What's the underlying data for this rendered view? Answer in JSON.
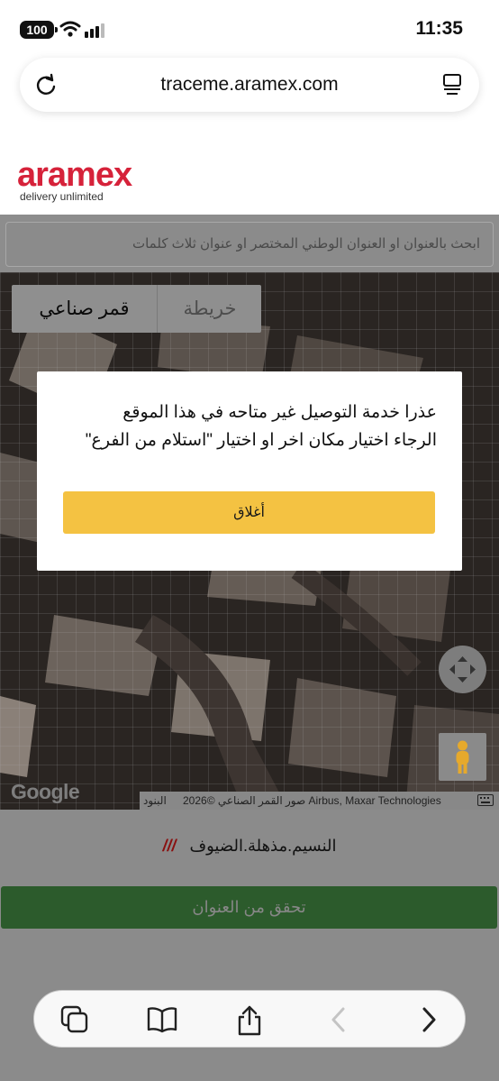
{
  "status_bar": {
    "battery": "100",
    "time": "11:35"
  },
  "browser": {
    "url": "traceme.aramex.com"
  },
  "header": {
    "brand": "aramex",
    "tagline": "delivery unlimited"
  },
  "search": {
    "placeholder": "ابحث بالعنوان او العنوان الوطني المختصر او عنوان ثلاث كلمات"
  },
  "map": {
    "type_toggle": {
      "satellite": "قمر صناعي",
      "map": "خريطة"
    },
    "attribution": {
      "terms": "البنود",
      "imagery": "صور القمر الصناعي ©2026 Airbus, Maxar Technologies"
    },
    "google": "Google"
  },
  "modal": {
    "line1": "عذرا خدمة التوصيل غير متاحه في هذا الموقع",
    "line2": "الرجاء اختيار مكان اخر او اختيار \"استلام من الفرع\"",
    "close_label": "أغلاق"
  },
  "address": {
    "words": "النسيم.مذهلة.الضيوف",
    "marker": "///"
  },
  "verify_button": "تحقق من العنوان",
  "colors": {
    "brand": "#d6223a",
    "modal_button": "#f4c242",
    "verify_button": "#2c5b2c"
  }
}
